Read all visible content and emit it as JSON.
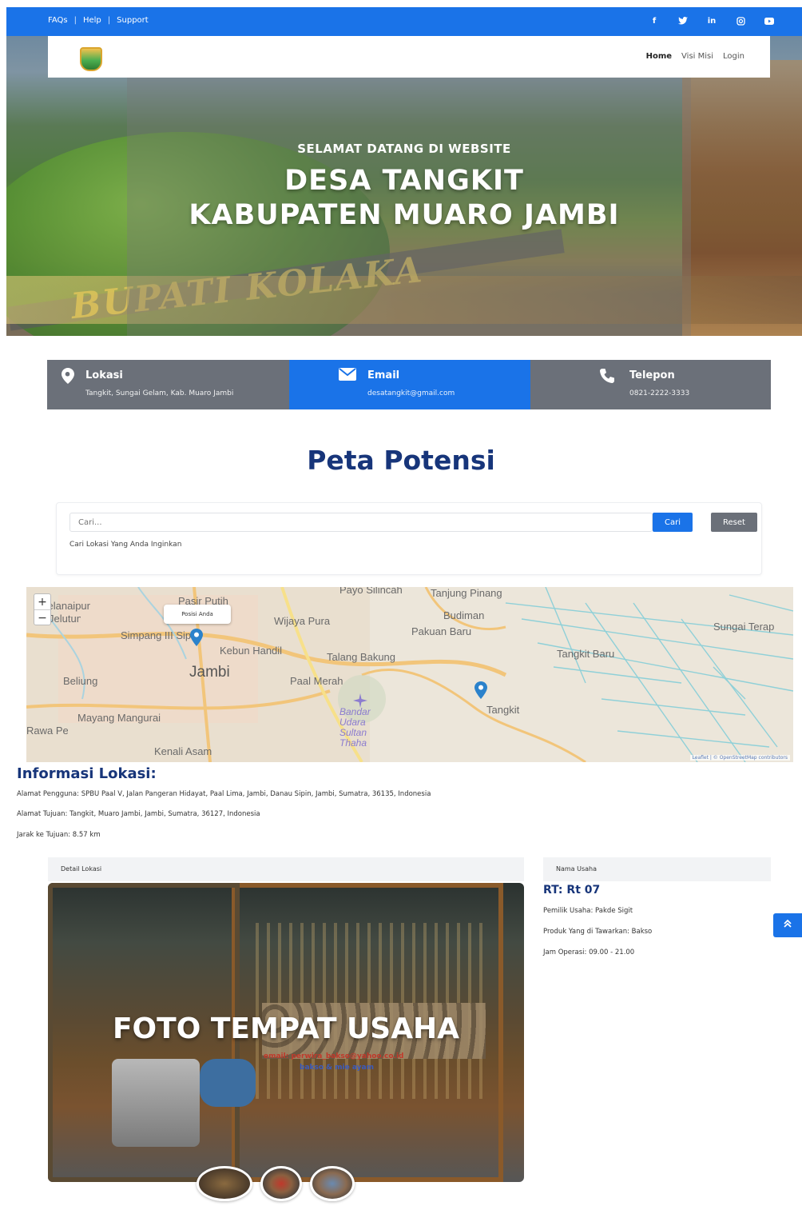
{
  "topbar": {
    "links": [
      "FAQs",
      "Help",
      "Support"
    ],
    "separator": "|",
    "social": [
      "f",
      "t",
      "in",
      "ig",
      "yt"
    ]
  },
  "navbar": {
    "items": [
      "Home",
      "Visi Misi",
      "Login"
    ]
  },
  "hero": {
    "subtitle": "SELAMAT DATANG DI WEBSITE",
    "title_line1": "DESA TANGKIT",
    "title_line2": "KABUPATEN MUARO JAMBI",
    "banner_text": "BUPATI KOLAKA"
  },
  "contact": {
    "lokasi": {
      "label": "Lokasi",
      "value": "Tangkit, Sungai Gelam, Kab. Muaro Jambi"
    },
    "email": {
      "label": "Email",
      "value": "desatangkit@gmail.com"
    },
    "telepon": {
      "label": "Telepon",
      "value": "0821-2222-3333"
    }
  },
  "section_title": "Peta Potensi",
  "search": {
    "placeholder": "Cari...",
    "button": "Cari",
    "reset": "Reset",
    "help": "Cari Lokasi Yang Anda Inginkan"
  },
  "map": {
    "labels": [
      "Pasir Putih",
      "Payo Silincah",
      "Tanjung Pinang",
      "Wijaya Pura",
      "Budiman",
      "Pakuan Baru",
      "Sungai Terap",
      "Simpang III Sipin",
      "Kebun Handil",
      "Talang Bakung",
      "Tangkit Baru",
      "Jambi",
      "Paal Merah",
      "Beliung",
      "Tangkit",
      "Mayang Mangurai",
      "Bandar Udara Sultan Thaha",
      "Kenali Asam",
      "Telanaipura",
      "Jelutung",
      "Rawa Pete"
    ],
    "popup": "Posisi Anda",
    "attribution": "Leaflet | © OpenStreetMap contributors",
    "zoom_in": "+",
    "zoom_out": "−"
  },
  "informasi": {
    "title": "Informasi Lokasi:",
    "alamat_pengguna": "Alamat Pengguna: SPBU Paal V, Jalan Pangeran Hidayat, Paal Lima, Jambi, Danau Sipin, Jambi, Sumatra, 36135, Indonesia",
    "alamat_tujuan": "Alamat Tujuan: Tangkit, Muaro Jambi, Jambi, Sumatra, 36127, Indonesia",
    "jarak": "Jarak ke Tujuan: 8.57 km"
  },
  "detail": {
    "header": "Detail Lokasi",
    "photo_caption": "FOTO TEMPAT USAHA",
    "photo_sign1": "email: perwira_bakso@yahoo.co.id",
    "photo_sign2": "bakso & mie ayam"
  },
  "usaha": {
    "header": "Nama Usaha",
    "rt": "RT: Rt 07",
    "pemilik": "Pemilik Usaha: Pakde Sigit",
    "produk": "Produk Yang di Tawarkan: Bakso",
    "jam": "Jam Operasi: 09.00 - 21.00"
  },
  "totop_icon": "double-chevron-up-icon"
}
